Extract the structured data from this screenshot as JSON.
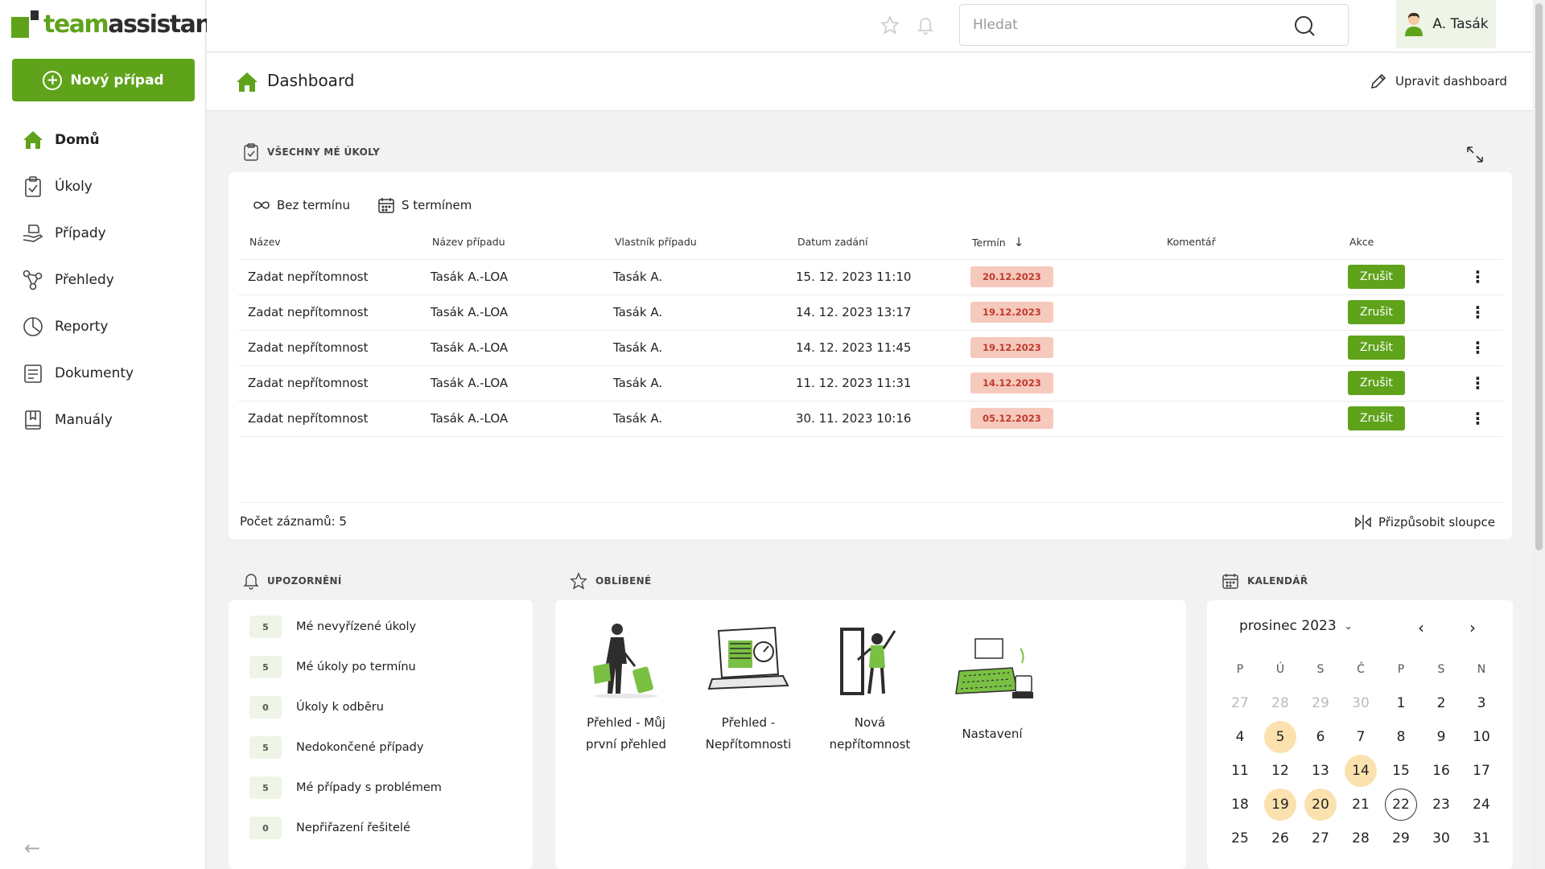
{
  "app": {
    "logo_part1": "team",
    "logo_part2": "assistant",
    "new_case_label": "Nový případ"
  },
  "sidebar": {
    "items": [
      {
        "label": "Domů",
        "icon": "home-icon",
        "active": true
      },
      {
        "label": "Úkoly",
        "icon": "clipboard-check-icon"
      },
      {
        "label": "Případy",
        "icon": "hand-folder-icon"
      },
      {
        "label": "Přehledy",
        "icon": "nodes-icon"
      },
      {
        "label": "Reporty",
        "icon": "clock-chart-icon"
      },
      {
        "label": "Dokumenty",
        "icon": "document-icon"
      },
      {
        "label": "Manuály",
        "icon": "book-icon"
      }
    ]
  },
  "topbar": {
    "search_placeholder": "Hledat",
    "user_name": "A. Tasák"
  },
  "page": {
    "title": "Dashboard",
    "edit_label": "Upravit dashboard"
  },
  "tasks": {
    "section_title": "VŠECHNY MÉ ÚKOLY",
    "tab_no_deadline": "Bez termínu",
    "tab_with_deadline": "S termínem",
    "columns": [
      "Název",
      "Název případu",
      "Vlastník případu",
      "Datum zadání",
      "Termín",
      "Komentář",
      "Akce"
    ],
    "rows": [
      {
        "name": "Zadat nepřítomnost",
        "case": "Tasák A.-LOA",
        "owner": "Tasák A.",
        "date": "15. 12. 2023 11:10",
        "deadline": "20.12.2023",
        "comment": "",
        "action": "Zrušit"
      },
      {
        "name": "Zadat nepřítomnost",
        "case": "Tasák A.-LOA",
        "owner": "Tasák A.",
        "date": "14. 12. 2023 13:17",
        "deadline": "19.12.2023",
        "comment": "",
        "action": "Zrušit"
      },
      {
        "name": "Zadat nepřítomnost",
        "case": "Tasák A.-LOA",
        "owner": "Tasák A.",
        "date": "14. 12. 2023 11:45",
        "deadline": "19.12.2023",
        "comment": "",
        "action": "Zrušit"
      },
      {
        "name": "Zadat nepřítomnost",
        "case": "Tasák A.-LOA",
        "owner": "Tasák A.",
        "date": "11. 12. 2023 11:31",
        "deadline": "14.12.2023",
        "comment": "",
        "action": "Zrušit"
      },
      {
        "name": "Zadat nepřítomnost",
        "case": "Tasák A.-LOA",
        "owner": "Tasák A.",
        "date": "30. 11. 2023 10:16",
        "deadline": "05.12.2023",
        "comment": "",
        "action": "Zrušit"
      }
    ],
    "count_label": "Počet záznamů: 5",
    "adjust_columns_label": "Přizpůsobit sloupce"
  },
  "notifications": {
    "section_title": "UPOZORNĚNÍ",
    "items": [
      {
        "count": "5",
        "label": "Mé nevyřízené úkoly"
      },
      {
        "count": "5",
        "label": "Mé úkoly po termínu"
      },
      {
        "count": "0",
        "label": "Úkoly k odběru"
      },
      {
        "count": "5",
        "label": "Nedokončené případy"
      },
      {
        "count": "5",
        "label": "Mé případy s problémem"
      },
      {
        "count": "0",
        "label": "Nepřiřazení řešitelé"
      }
    ]
  },
  "favorites": {
    "section_title": "OBLÍBENÉ",
    "items": [
      {
        "line1": "Přehled - Můj",
        "line2": "první přehled"
      },
      {
        "line1": "Přehled -",
        "line2": "Nepřítomnosti"
      },
      {
        "line1": "Nová",
        "line2": "nepřítomnost"
      },
      {
        "line1": "Nastavení",
        "line2": ""
      }
    ]
  },
  "calendar": {
    "section_title": "KALENDÁŘ",
    "month_label": "prosinec 2023",
    "weekdays": [
      "P",
      "Ú",
      "S",
      "Č",
      "P",
      "S",
      "N"
    ],
    "days": [
      {
        "d": "27",
        "muted": true
      },
      {
        "d": "28",
        "muted": true
      },
      {
        "d": "29",
        "muted": true
      },
      {
        "d": "30",
        "muted": true
      },
      {
        "d": "1"
      },
      {
        "d": "2"
      },
      {
        "d": "3"
      },
      {
        "d": "4"
      },
      {
        "d": "5",
        "highlight": true
      },
      {
        "d": "6"
      },
      {
        "d": "7"
      },
      {
        "d": "8"
      },
      {
        "d": "9"
      },
      {
        "d": "10"
      },
      {
        "d": "11"
      },
      {
        "d": "12"
      },
      {
        "d": "13"
      },
      {
        "d": "14",
        "highlight": true
      },
      {
        "d": "15"
      },
      {
        "d": "16"
      },
      {
        "d": "17"
      },
      {
        "d": "18"
      },
      {
        "d": "19",
        "highlight": true
      },
      {
        "d": "20",
        "highlight": true
      },
      {
        "d": "21"
      },
      {
        "d": "22",
        "today": true
      },
      {
        "d": "23"
      },
      {
        "d": "24"
      },
      {
        "d": "25"
      },
      {
        "d": "26"
      },
      {
        "d": "27"
      },
      {
        "d": "28"
      },
      {
        "d": "29"
      },
      {
        "d": "30"
      },
      {
        "d": "31"
      }
    ]
  },
  "colors": {
    "brand_green": "#5fa31b",
    "deadline_bg": "#f6c9bd",
    "deadline_text": "#c0392b",
    "calendar_highlight": "#fbe1ae"
  }
}
